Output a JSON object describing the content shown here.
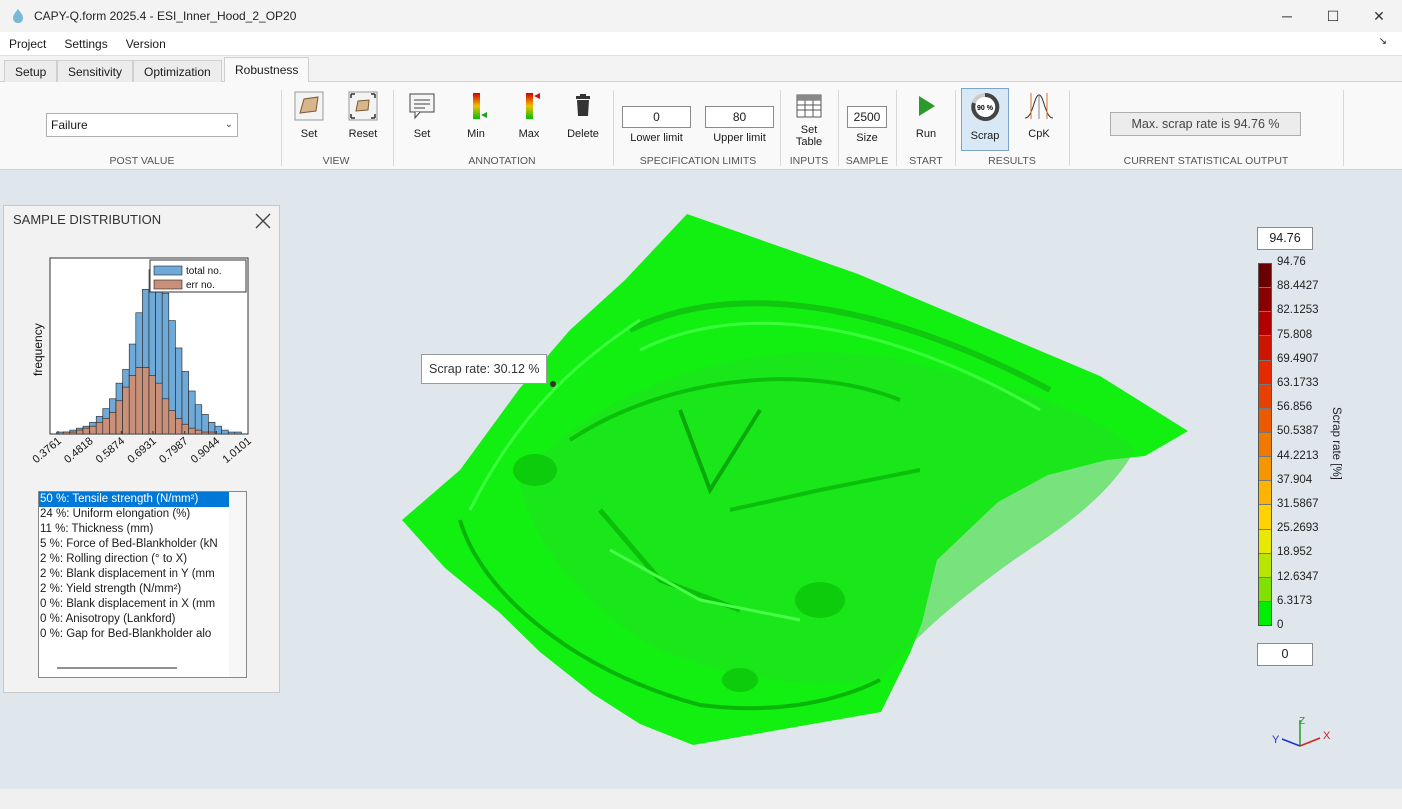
{
  "window": {
    "title": "CAPY-Q.form 2025.4 - ESI_Inner_Hood_2_OP20",
    "minimize": "─",
    "maximize": "☐",
    "close": "✕"
  },
  "menu": {
    "project": "Project",
    "settings": "Settings",
    "version": "Version",
    "corner": "↘"
  },
  "tabs": [
    "Setup",
    "Sensitivity",
    "Optimization",
    "Robustness"
  ],
  "ribbon": {
    "post_value": {
      "selected": "Failure",
      "group": "POST VALUE"
    },
    "view": {
      "set": "Set",
      "reset": "Reset",
      "group": "VIEW"
    },
    "annotation": {
      "set": "Set",
      "min": "Min",
      "max": "Max",
      "delete": "Delete",
      "group": "ANNOTATION"
    },
    "spec_limits": {
      "lower_value": "0",
      "upper_value": "80",
      "lower_label": "Lower limit",
      "upper_label": "Upper limit",
      "group": "SPECIFICATION LIMITS"
    },
    "inputs": {
      "set_table_line1": "Set",
      "set_table_line2": "Table",
      "group": "INPUTS"
    },
    "sample": {
      "value": "2500",
      "label": "Size",
      "group": "SAMPLE"
    },
    "start": {
      "run": "Run",
      "group": "START"
    },
    "results": {
      "scrap": "Scrap",
      "cpk": "CpK",
      "scrap_icon_text": "90 %",
      "group": "RESULTS"
    },
    "stat_output": {
      "text": "Max. scrap rate is 94.76 %",
      "group": "CURRENT STATISTICAL OUTPUT"
    }
  },
  "sample_distribution": {
    "title": "SAMPLE DISTRIBUTION",
    "legend": [
      "total no.",
      "err no."
    ],
    "ylabel": "frequency",
    "xticks": [
      "0.3761",
      "0.4818",
      "0.5874",
      "0.6931",
      "0.7987",
      "0.9044",
      "1.0101"
    ],
    "list": [
      "50 %:  Tensile strength (N/mm²)",
      "24 %:  Uniform elongation (%)",
      "11 %:  Thickness (mm)",
      "5 %:    Force of Bed-Blankholder (kN",
      "2 %:    Rolling direction (° to X)",
      "2 %:    Blank displacement in Y (mm",
      "2 %:    Yield strength (N/mm²)",
      "0 %:    Blank displacement in X (mm",
      "0 %:    Anisotropy (Lankford)",
      "0 %:    Gap for Bed-Blankholder alo"
    ]
  },
  "chart_data": {
    "type": "bar",
    "title": "",
    "xlabel": "",
    "ylabel": "frequency",
    "categories": [
      "0.3761",
      "0.4818",
      "0.5874",
      "0.6931",
      "0.7987",
      "0.9044",
      "1.0101"
    ],
    "series": [
      {
        "name": "total no.",
        "values": [
          1,
          1,
          2,
          3,
          4,
          6,
          9,
          13,
          18,
          26,
          33,
          46,
          62,
          74,
          84,
          80,
          72,
          58,
          44,
          32,
          22,
          15,
          10,
          6,
          4,
          2,
          1,
          1
        ]
      },
      {
        "name": "err no.",
        "values": [
          0,
          1,
          1,
          2,
          3,
          4,
          6,
          8,
          11,
          17,
          24,
          30,
          34,
          34,
          30,
          26,
          18,
          12,
          8,
          5,
          3,
          2,
          1,
          1,
          0,
          0,
          0,
          0
        ]
      }
    ],
    "ylim": [
      0,
      90
    ]
  },
  "viewport": {
    "tooltip": "Scrap rate: 30.12 %",
    "colorbar": {
      "max_box": "94.76",
      "min_box": "0",
      "title": "Scrap rate [%]",
      "labels": [
        "94.76",
        "88.4427",
        "82.1253",
        "75.808",
        "69.4907",
        "63.1733",
        "56.856",
        "50.5387",
        "44.2213",
        "37.904",
        "31.5867",
        "25.2693",
        "18.952",
        "12.6347",
        "6.3173",
        "0"
      ],
      "colors": [
        "#6b0000",
        "#8a0000",
        "#b00000",
        "#cc1500",
        "#e32a00",
        "#e84000",
        "#ec5a00",
        "#f07a00",
        "#f59500",
        "#fbb400",
        "#ffd200",
        "#e9e900",
        "#b8e600",
        "#80e000",
        "#00ee00"
      ]
    },
    "triad": {
      "x": "X",
      "y": "Y",
      "z": "Z"
    }
  },
  "colors": {
    "part_green": "#11f011",
    "viewport_bg": "#dfe7ec",
    "selection_blue": "#0078d7"
  }
}
